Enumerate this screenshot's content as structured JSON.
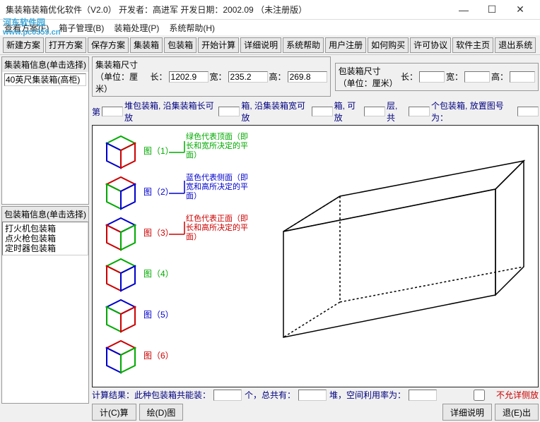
{
  "window": {
    "title": "集装箱装箱优化软件（V2.0） 开发者：高进军 开发日期：2002.09 （未注册版）"
  },
  "menu": {
    "scheme": "查看方案(F)",
    "box_mgmt": "箱子管理(B)",
    "pack_proc": "装箱处理(P)",
    "help": "系统帮助(H)"
  },
  "watermark": {
    "name": "河东软件园",
    "url": "www.pc0359.cn"
  },
  "toolbar": {
    "new_scheme": "新建方案",
    "open_scheme": "打开方案",
    "save_scheme": "保存方案",
    "container": "集装箱",
    "package": "包装箱",
    "start_calc": "开始计算",
    "detail": "详细说明",
    "sys_help": "系统帮助",
    "register": "用户注册",
    "how_buy": "如何购买",
    "license": "许可协议",
    "homepage": "软件主页",
    "exit": "退出系统"
  },
  "left": {
    "container_info_hdr": "集装箱信息(单击选择)",
    "container_item": "40英尺集装箱(高柜)",
    "package_info_hdr": "包装箱信息(单击选择)",
    "package_items": [
      "打火机包装箱",
      "点火枪包装箱",
      "定时器包装箱"
    ]
  },
  "dims": {
    "container_label": "集装箱尺寸（单位：厘米）",
    "package_label": "包装箱尺寸（单位：厘米）",
    "length_lbl": "长：",
    "width_lbl": "宽：",
    "height_lbl": "高：",
    "c_length": "1202.9",
    "c_width": "235.2",
    "c_height": "269.8",
    "p_length": "",
    "p_width": "",
    "p_height": ""
  },
  "status": {
    "first": "第",
    "stack": "堆包装箱, 沿集装箱长可放",
    "along_w": "箱, 沿集装箱宽可放",
    "box_can": "箱, 可放",
    "layers": "层, 共",
    "pkg_place": "个包装箱, 放置图号为："
  },
  "legend": {
    "green": "绿色代表顶面（即长和宽所决定的平面）",
    "blue": "蓝色代表侧面（即宽和高所决定的平面）",
    "red": "红色代表正面（即长和高所决定的平面）",
    "fig1": "图（1）",
    "fig2": "图（2）",
    "fig3": "图（3）",
    "fig4": "图（4）",
    "fig5": "图（5）",
    "fig6": "图（6）"
  },
  "results": {
    "calc_result": "计算结果：此种包装箱共能装：",
    "total": "个，总共有：",
    "stack_util": "堆，空间利用率为：",
    "no_side": "不允详侧放"
  },
  "buttons": {
    "calc": "计(C)算",
    "draw": "绘(D)图",
    "detail": "详细说明",
    "exit": "退(E)出"
  }
}
